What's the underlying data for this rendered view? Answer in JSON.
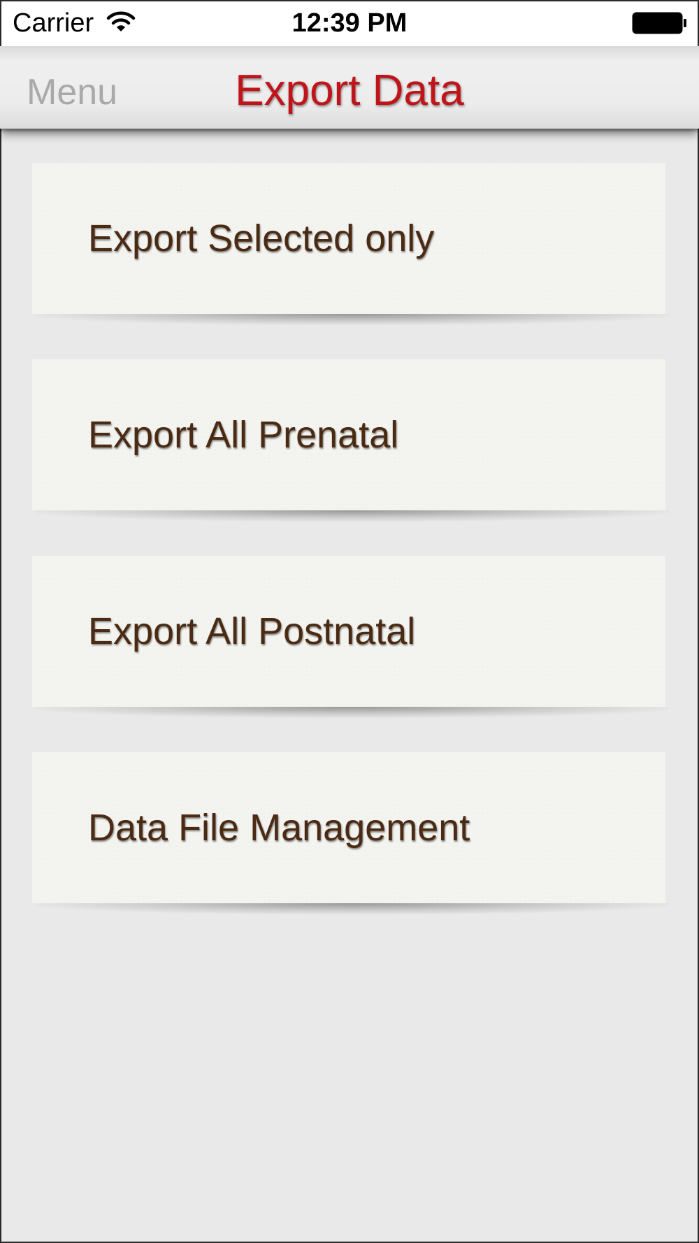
{
  "status_bar": {
    "carrier": "Carrier",
    "time": "12:39 PM",
    "wifi_icon": "wifi-icon",
    "battery_icon": "battery-icon"
  },
  "nav_bar": {
    "menu_label": "Menu",
    "title": "Export Data",
    "title_color": "#c0141a"
  },
  "options": [
    {
      "label": "Export Selected only"
    },
    {
      "label": "Export All Prenatal"
    },
    {
      "label": "Export All Postnatal"
    },
    {
      "label": "Data File Management"
    }
  ]
}
